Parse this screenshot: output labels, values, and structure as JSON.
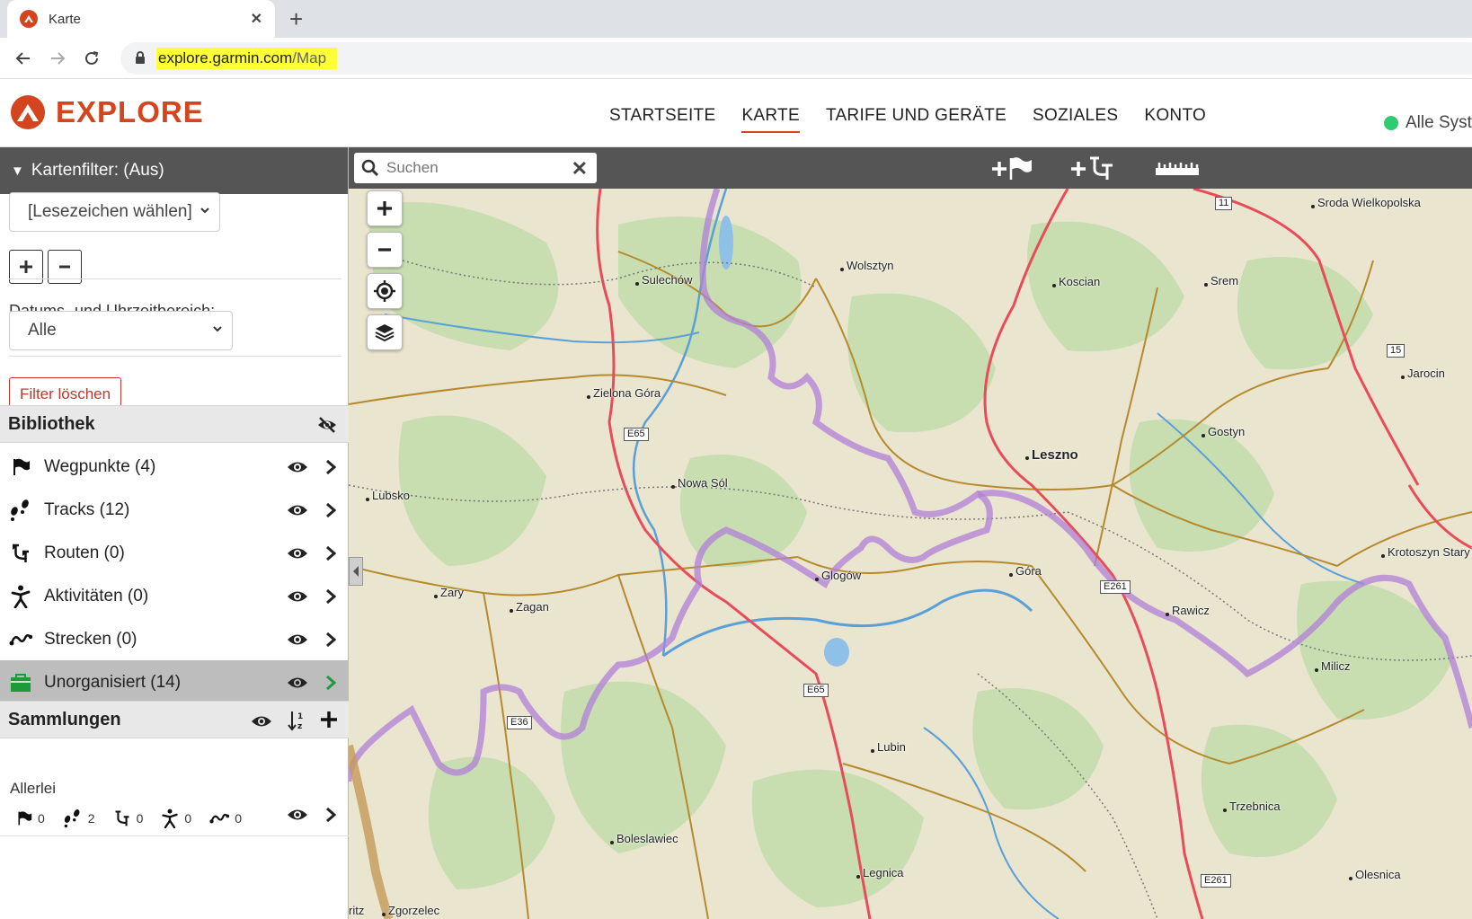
{
  "browser": {
    "tab_title": "Karte",
    "url_host": "explore.garmin.com",
    "url_path": "/Map"
  },
  "header": {
    "brand": "EXPLORE",
    "nav": [
      "STARTSEITE",
      "KARTE",
      "TARIFE UND GERÄTE",
      "SOZIALES",
      "KONTO"
    ],
    "active_nav": "KARTE",
    "status_text": "Alle Syst"
  },
  "sidebar": {
    "filter_title": "Kartenfilter: (Aus)",
    "bookmark_select": "[Lesezeichen wählen]",
    "datetime_label": "Datums- und Uhrzeitbereich:",
    "datetime_select": "Alle",
    "clear_filter": "Filter löschen",
    "library_title": "Bibliothek",
    "library": [
      {
        "label": "Wegpunkte (4)",
        "icon": "flag-icon"
      },
      {
        "label": "Tracks (12)",
        "icon": "footprints-icon"
      },
      {
        "label": "Routen (0)",
        "icon": "route-icon"
      },
      {
        "label": "Aktivitäten (0)",
        "icon": "person-icon"
      },
      {
        "label": "Strecken (0)",
        "icon": "course-icon"
      },
      {
        "label": "Unorganisiert (14)",
        "icon": "folder-icon",
        "selected": true
      }
    ],
    "collections_title": "Sammlungen",
    "collection": {
      "name": "Allerlei",
      "counts": [
        "0",
        "2",
        "0",
        "0",
        "0"
      ]
    }
  },
  "map": {
    "search_placeholder": "Suchen",
    "places": [
      {
        "name": "Wolsztyn"
      },
      {
        "name": "Sulechów"
      },
      {
        "name": "Koscian"
      },
      {
        "name": "Srem"
      },
      {
        "name": "Sroda Wielkopolska"
      },
      {
        "name": "Zielona Góra"
      },
      {
        "name": "Leszno",
        "major": true
      },
      {
        "name": "Gostyn"
      },
      {
        "name": "Jarocin"
      },
      {
        "name": "Nowa Sól"
      },
      {
        "name": "Lubsko"
      },
      {
        "name": "Glogów"
      },
      {
        "name": "Góra"
      },
      {
        "name": "Krotoszyn Stary"
      },
      {
        "name": "Zary"
      },
      {
        "name": "Zagan"
      },
      {
        "name": "Rawicz"
      },
      {
        "name": "Milicz"
      },
      {
        "name": "Lubin"
      },
      {
        "name": "Trzebnica"
      },
      {
        "name": "Boleslawiec"
      },
      {
        "name": "Legnica"
      },
      {
        "name": "Olesnica"
      },
      {
        "name": "Zgorzelec"
      },
      {
        "name": "ritz"
      }
    ],
    "road_shields": [
      "11",
      "15",
      "E65",
      "E261",
      "E65",
      "E36",
      "E261"
    ],
    "colors": {
      "land": "#eae5cf",
      "forest": "#c8deb0",
      "road_major": "#e84c5a",
      "road_minor": "#b58a2d",
      "border": "#b07fd8",
      "water": "#5aa0d8"
    }
  }
}
